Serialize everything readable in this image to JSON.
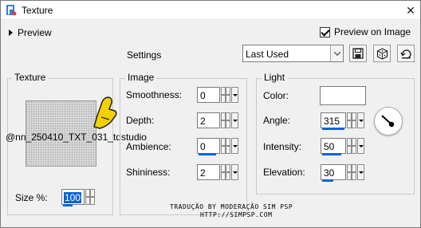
{
  "window": {
    "title": "Texture"
  },
  "header": {
    "preview_label": "Preview",
    "preview_on_image_label": "Preview on Image",
    "settings_label": "Settings",
    "settings_value": "Last Used"
  },
  "texture_group": {
    "legend": "Texture",
    "watermark": "@nn_250410_TXT_031_tdstudio",
    "size_label": "Size %:",
    "size_value": "100"
  },
  "image_group": {
    "legend": "Image",
    "smoothness_label": "Smoothness:",
    "smoothness_value": "0",
    "depth_label": "Depth:",
    "depth_value": "2",
    "ambience_label": "Ambience:",
    "ambience_value": "0",
    "shininess_label": "Shininess:",
    "shininess_value": "2"
  },
  "light_group": {
    "legend": "Light",
    "color_label": "Color:",
    "color_value": "#ffffff",
    "angle_label": "Angle:",
    "angle_value": "315",
    "intensity_label": "Intensity:",
    "intensity_value": "50",
    "elevation_label": "Elevation:",
    "elevation_value": "30"
  },
  "credit": {
    "line1": "TRADUÇÃO BY MODERAÇÃO SIM PSP",
    "line2": "HTTP://SIMPSP.COM"
  },
  "icons": [
    "app-icon",
    "close-icon",
    "save-icon",
    "dice-icon",
    "reset-icon",
    "pointer-hand-icon",
    "angle-dial-icon"
  ],
  "colors": {
    "accent_blue": "#0a64d6",
    "hand_yellow": "#f5d000"
  }
}
